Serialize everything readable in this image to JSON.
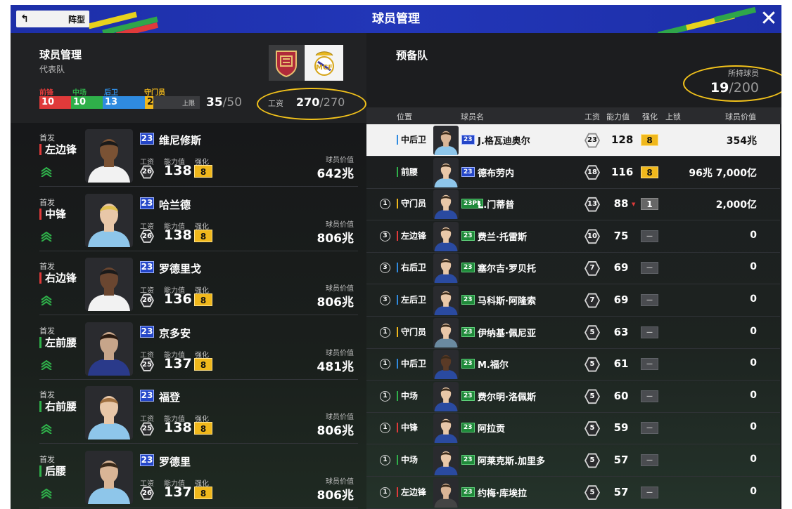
{
  "header": {
    "title": "球员管理",
    "back_label": "阵型",
    "close_label": "✕"
  },
  "team": {
    "title": "球员管理",
    "subtitle": "代表队",
    "position_labels": [
      "前锋",
      "中场",
      "后卫",
      "守门员"
    ],
    "position_counts": [
      "10",
      "10",
      "13",
      "2"
    ],
    "position_colors": [
      "#e03a3a",
      "#2fb04a",
      "#2f8be0",
      "#f0b81c"
    ],
    "cap_label": "上限",
    "squad_count": "35",
    "squad_max": "/50",
    "wage_label": "工资",
    "wage_used": "270",
    "wage_max": "/270"
  },
  "lineup_labels": {
    "starter": "首发",
    "wage": "工资",
    "ability": "能力值",
    "enhance": "强化",
    "value": "球员价值"
  },
  "lineup": [
    {
      "position": "左边锋",
      "season": "23",
      "name": "维尼修斯",
      "wage": "26",
      "ovr": "138",
      "enhance": "8",
      "value": "642兆",
      "pos_color": "#e03a3a"
    },
    {
      "position": "中锋",
      "season": "23",
      "name": "哈兰德",
      "wage": "26",
      "ovr": "138",
      "enhance": "8",
      "value": "806兆",
      "pos_color": "#e03a3a"
    },
    {
      "position": "右边锋",
      "season": "23",
      "name": "罗德里戈",
      "wage": "26",
      "ovr": "136",
      "enhance": "8",
      "value": "806兆",
      "pos_color": "#e03a3a"
    },
    {
      "position": "左前腰",
      "season": "23",
      "name": "京多安",
      "wage": "25",
      "ovr": "137",
      "enhance": "8",
      "value": "481兆",
      "pos_color": "#2fb04a"
    },
    {
      "position": "右前腰",
      "season": "23",
      "name": "福登",
      "wage": "25",
      "ovr": "138",
      "enhance": "8",
      "value": "806兆",
      "pos_color": "#2fb04a"
    },
    {
      "position": "后腰",
      "season": "23",
      "name": "罗德里",
      "wage": "26",
      "ovr": "137",
      "enhance": "8",
      "value": "806兆",
      "pos_color": "#2fb04a"
    }
  ],
  "reserve": {
    "title": "预备队",
    "owned_label": "所持球员",
    "owned_count": "19",
    "owned_max": "/200",
    "columns": [
      "位置",
      "球员名",
      "工资",
      "能力值",
      "强化",
      "上锁",
      "球员价值"
    ],
    "rows": [
      {
        "count": "",
        "position": "中后卫",
        "pos_color": "#2f8be0",
        "season": "23",
        "season_style": "blue",
        "name": "J.格瓦迪奥尔",
        "wage": "23",
        "ovr": "128",
        "enhance": "8",
        "value": "354兆",
        "selected": true
      },
      {
        "count": "",
        "position": "前腰",
        "pos_color": "#2fb04a",
        "season": "23",
        "season_style": "blue",
        "name": "德布劳内",
        "wage": "18",
        "ovr": "116",
        "enhance": "8",
        "value": "96兆 7,000亿"
      },
      {
        "count": "1",
        "position": "守门员",
        "pos_color": "#f0b81c",
        "season": "23PL",
        "season_style": "green",
        "name": "L.门蒂普",
        "wage": "13",
        "ovr": "88",
        "enhance": "1",
        "value": "2,000亿",
        "arrow": "▼"
      },
      {
        "count": "3",
        "position": "左边锋",
        "pos_color": "#e03a3a",
        "season": "23",
        "season_style": "green",
        "name": "费兰·托雷斯",
        "wage": "10",
        "ovr": "75",
        "enhance": "—",
        "value": "0"
      },
      {
        "count": "3",
        "position": "右后卫",
        "pos_color": "#2f8be0",
        "season": "23",
        "season_style": "green",
        "name": "塞尔吉·罗贝托",
        "wage": "7",
        "ovr": "69",
        "enhance": "—",
        "value": "0"
      },
      {
        "count": "3",
        "position": "左后卫",
        "pos_color": "#2f8be0",
        "season": "23",
        "season_style": "green",
        "name": "马科斯·阿隆索",
        "wage": "7",
        "ovr": "69",
        "enhance": "—",
        "value": "0"
      },
      {
        "count": "1",
        "position": "守门员",
        "pos_color": "#f0b81c",
        "season": "23",
        "season_style": "green",
        "name": "伊纳基·佩尼亚",
        "wage": "5",
        "ovr": "63",
        "enhance": "—",
        "value": "0"
      },
      {
        "count": "1",
        "position": "中后卫",
        "pos_color": "#2f8be0",
        "season": "23",
        "season_style": "green",
        "name": "M.福尔",
        "wage": "5",
        "ovr": "61",
        "enhance": "—",
        "value": "0"
      },
      {
        "count": "1",
        "position": "中场",
        "pos_color": "#2fb04a",
        "season": "23",
        "season_style": "green",
        "name": "费尔明·洛佩斯",
        "wage": "5",
        "ovr": "60",
        "enhance": "—",
        "value": "0"
      },
      {
        "count": "1",
        "position": "中锋",
        "pos_color": "#e03a3a",
        "season": "23",
        "season_style": "green",
        "name": "阿拉贡",
        "wage": "5",
        "ovr": "59",
        "enhance": "—",
        "value": "0"
      },
      {
        "count": "1",
        "position": "中场",
        "pos_color": "#2fb04a",
        "season": "23",
        "season_style": "green",
        "name": "阿莱克斯.加里多",
        "wage": "5",
        "ovr": "57",
        "enhance": "—",
        "value": "0"
      },
      {
        "count": "1",
        "position": "左边锋",
        "pos_color": "#e03a3a",
        "season": "23",
        "season_style": "green",
        "name": "约梅·库埃拉",
        "wage": "5",
        "ovr": "57",
        "enhance": "—",
        "value": "0"
      }
    ]
  }
}
